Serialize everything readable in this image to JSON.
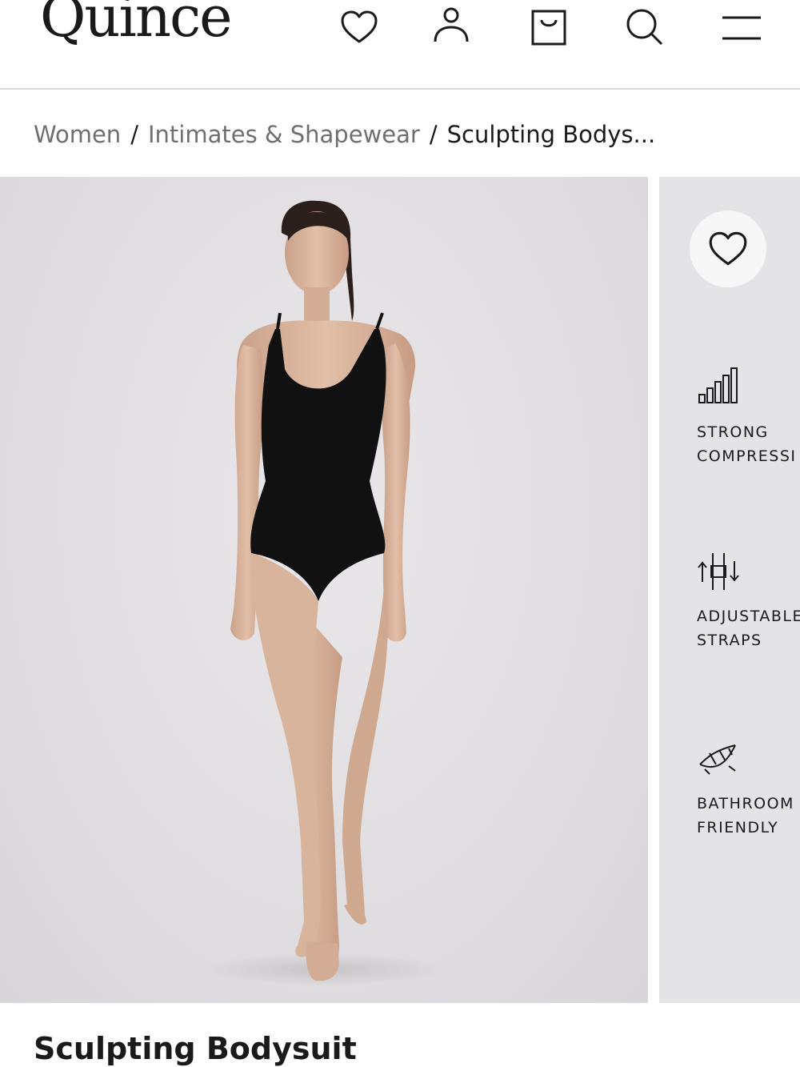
{
  "header": {
    "logo": "Quince",
    "icons": [
      "heart-icon",
      "user-icon",
      "shopping-bag-icon",
      "search-icon",
      "menu-icon"
    ]
  },
  "breadcrumb": {
    "items": [
      "Women",
      "Intimates & Shapewear",
      "Sculpting Bodys..."
    ],
    "separator": "/"
  },
  "gallery": {
    "features": [
      {
        "icon": "compression-bars-icon",
        "label": "STRONG\nCOMPRESSI"
      },
      {
        "icon": "adjustable-straps-icon",
        "label": "ADJUSTABLE\nSTRAPS"
      },
      {
        "icon": "bathroom-friendly-icon",
        "label": "BATHROOM\nFRIENDLY"
      }
    ]
  },
  "product": {
    "title": "Sculpting Bodysuit"
  },
  "colors": {
    "text": "#1a1a1a",
    "muted": "#6f6f6f",
    "photo_bg": "#e0dee1",
    "garment": "#111111",
    "skin": "#d9b49c"
  }
}
